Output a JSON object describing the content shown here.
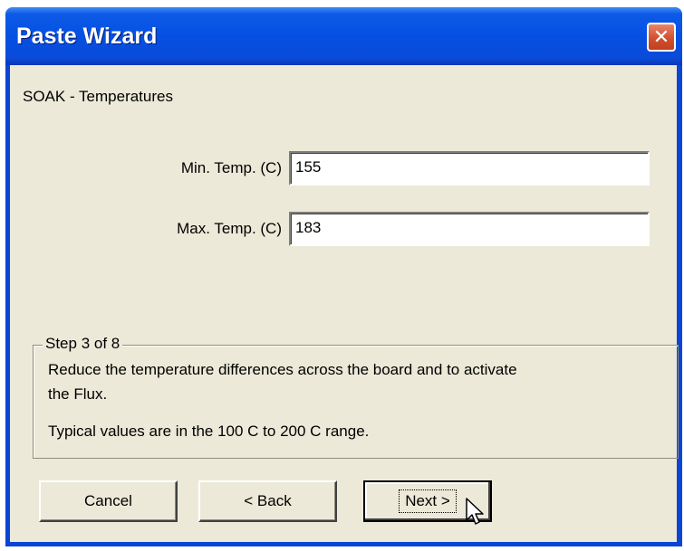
{
  "window": {
    "title": "Paste Wizard",
    "close_symbol": "✕"
  },
  "page": {
    "heading": "SOAK - Temperatures"
  },
  "fields": {
    "min_temp": {
      "label": "Min. Temp. (C)",
      "value": "155"
    },
    "max_temp": {
      "label": "Max. Temp. (C)",
      "value": "183"
    }
  },
  "step_group": {
    "legend": "Step 3 of 8",
    "line1": "Reduce the temperature differences across the board and to activate",
    "line2": "the Flux.",
    "line3": "Typical values are in the 100 C to 200 C range."
  },
  "buttons": {
    "cancel": "Cancel",
    "back": "< Back",
    "next": "Next >"
  },
  "icons": {
    "close": "close-icon",
    "cursor": "mouse-pointer-icon"
  },
  "colors": {
    "titlebar": "#0550e3",
    "dialog_bg": "#ece9d8",
    "close_button": "#d2502f"
  }
}
